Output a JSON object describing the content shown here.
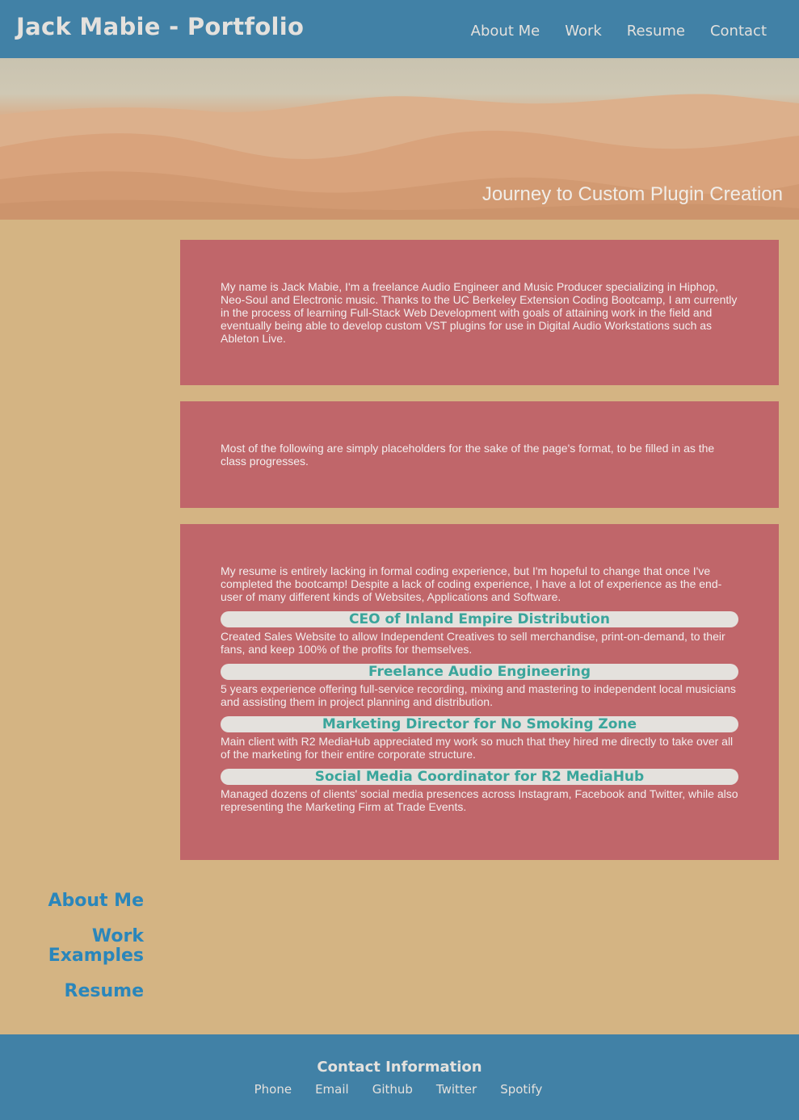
{
  "header": {
    "title": "Jack Mabie - Portfolio",
    "nav": [
      "About Me",
      "Work",
      "Resume",
      "Contact"
    ]
  },
  "hero": {
    "caption": "Journey to Custom Plugin Creation"
  },
  "about": {
    "text": "My name is Jack Mabie, I'm a freelance Audio Engineer and Music Producer specializing in Hiphop, Neo-Soul and Electronic music. Thanks to the UC Berkeley Extension Coding Bootcamp, I am currently in the process of learning Full-Stack Web Development with goals of attaining work in the field and eventually being able to develop custom VST plugins for use in Digital Audio Workstations such as Ableton Live."
  },
  "work": {
    "text": "Most of the following are simply placeholders for the sake of the page's format, to be filled in as the class progresses."
  },
  "resume": {
    "intro": "My resume is entirely lacking in formal coding experience, but I'm hopeful to change that once I've completed the bootcamp! Despite a lack of coding experience, I have a lot of experience as the end-user of many different kinds of Websites, Applications and Software.",
    "jobs": [
      {
        "title": "CEO of Inland Empire Distribution",
        "desc": "Created Sales Website to allow Independent Creatives to sell merchandise, print-on-demand, to their fans, and keep 100% of the profits for themselves."
      },
      {
        "title": "Freelance Audio Engineering",
        "desc": "5 years experience offering full-service recording, mixing and mastering to independent local musicians and assisting them in project planning and distribution."
      },
      {
        "title": "Marketing Director for No Smoking Zone",
        "desc": "Main client with R2 MediaHub appreciated my work so much that they hired me directly to take over all of the marketing for their entire corporate structure."
      },
      {
        "title": "Social Media Coordinator for R2 MediaHub",
        "desc": "Managed dozens of clients' social media presences across Instagram, Facebook and Twitter, while also representing the Marketing Firm at Trade Events."
      }
    ]
  },
  "side_nav": [
    "About Me",
    "Work Examples",
    "Resume"
  ],
  "footer": {
    "title": "Contact Information",
    "links": [
      "Phone",
      "Email",
      "Github",
      "Twitter",
      "Spotify"
    ]
  },
  "colors": {
    "header_bg": "#4181a6",
    "page_bg": "#d4b483",
    "card_bg": "#c0666a",
    "job_title_bg": "#e4e1dd",
    "job_title_text": "#3aa59b",
    "side_nav_text": "#2a86bb"
  }
}
